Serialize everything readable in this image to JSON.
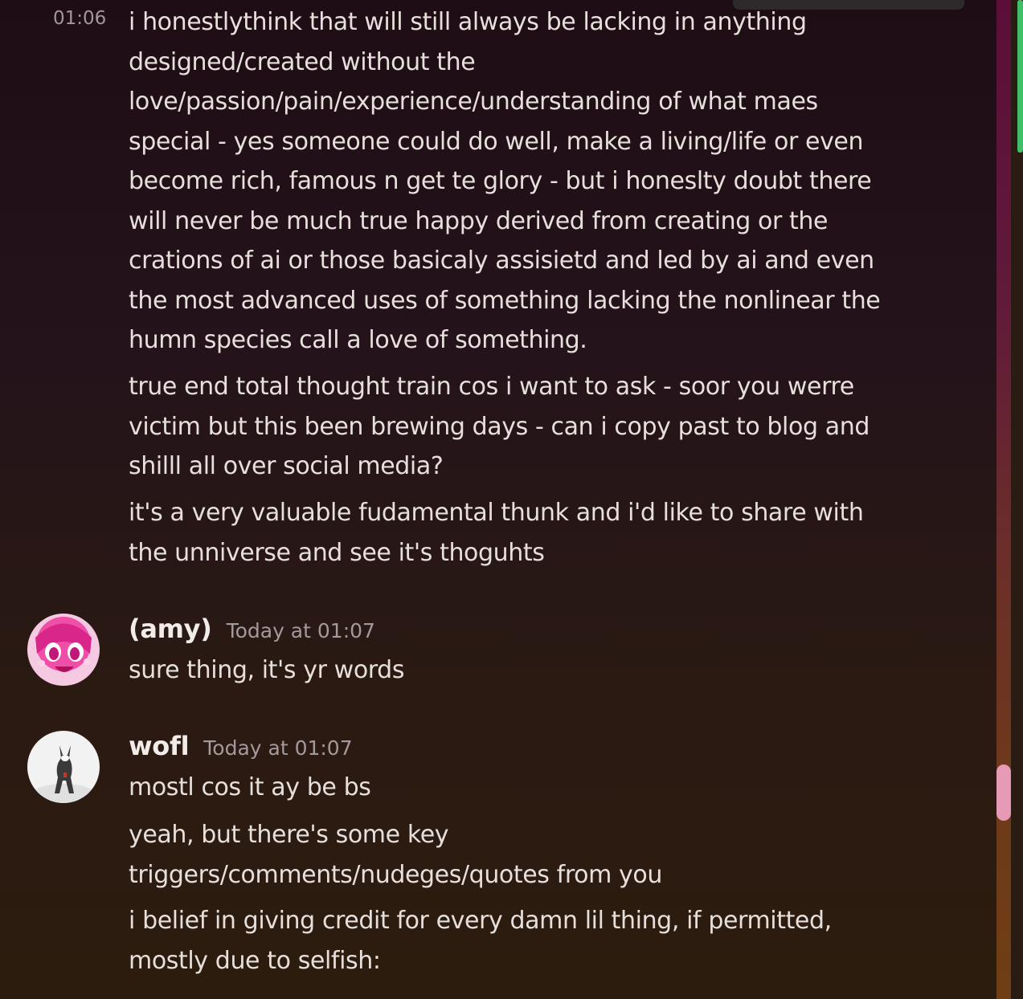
{
  "message_group_1": {
    "gutter_time": "01:06",
    "lines": [
      "i honestlythink that will still always be lacking in anything designed/created without the love/passion/pain/experience/understanding of what maes special - yes someone could do well, make a living/life or even become rich, famous n get te glory - but i honeslty doubt there will never be much true happy derived from creating or the crations of ai or those basicaly assisietd and led by ai and even the most advanced uses of something lacking the nonlinear the humn species call a love of something.",
      "true end total thought train cos i want to ask - soor you werre victim but this been brewing days - can i copy past to blog and shilll all over social media?",
      "it's a very valuable fudamental thunk and i'd like to share with the unniverse and see it's thoguhts"
    ]
  },
  "message_amy": {
    "author": "(amy)",
    "time": "Today at 01:07",
    "lines": [
      "sure thing, it's yr words"
    ]
  },
  "message_wofl": {
    "author": "wofl",
    "time": "Today at 01:07",
    "lines": [
      "mostl cos it ay be bs",
      "yeah, but there's some key triggers/comments/nudeges/quotes from you",
      "i belief in giving credit for every damn lil thing, if permitted, mostly due to selfish:"
    ]
  },
  "colors": {
    "scroll_thumb": "#e79ab6",
    "accent_green": "#3fbf6a"
  }
}
